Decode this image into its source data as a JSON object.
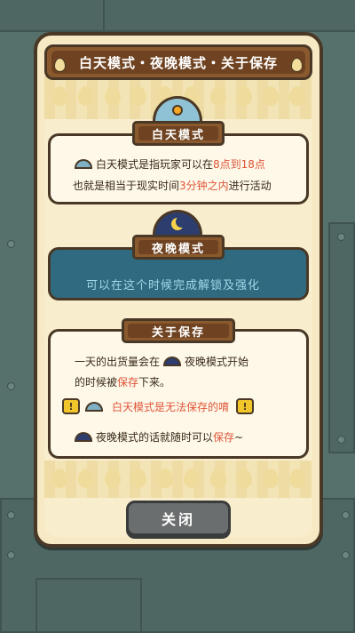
{
  "title": "白天模式・夜晚模式・关于保存",
  "day_section": {
    "label": "白天模式",
    "line1_prefix": "白天模式是指玩家可以在",
    "line1_highlight": "8点到18点",
    "line2_prefix": "也就是相当于现实时间",
    "line2_highlight": "3分钟之内",
    "line2_suffix": "进行活动"
  },
  "night_section": {
    "label": "夜晚模式",
    "text": "可以在这个时候完成解锁及强化"
  },
  "save_section": {
    "label": "关于保存",
    "line1_prefix": "一天的出货量会在",
    "line1_suffix": "夜晚模式开始",
    "line2_prefix": "的时候被",
    "line2_highlight": "保存",
    "line2_suffix": "下来。",
    "line3_warning": "白天模式是无法保存的唷",
    "line4_prefix": "夜晚模式的话就随时可以",
    "line4_highlight": "保存",
    "line4_suffix": "~"
  },
  "close_button": "关闭",
  "icons": {
    "day": "sun-dome-icon",
    "night": "moon-dome-icon",
    "warning": "warning-icon"
  },
  "colors": {
    "highlight": "#e0553a",
    "night_box": "#2f6a80",
    "card_bg": "#f6e9c3",
    "wood": "#8a5a2e"
  }
}
